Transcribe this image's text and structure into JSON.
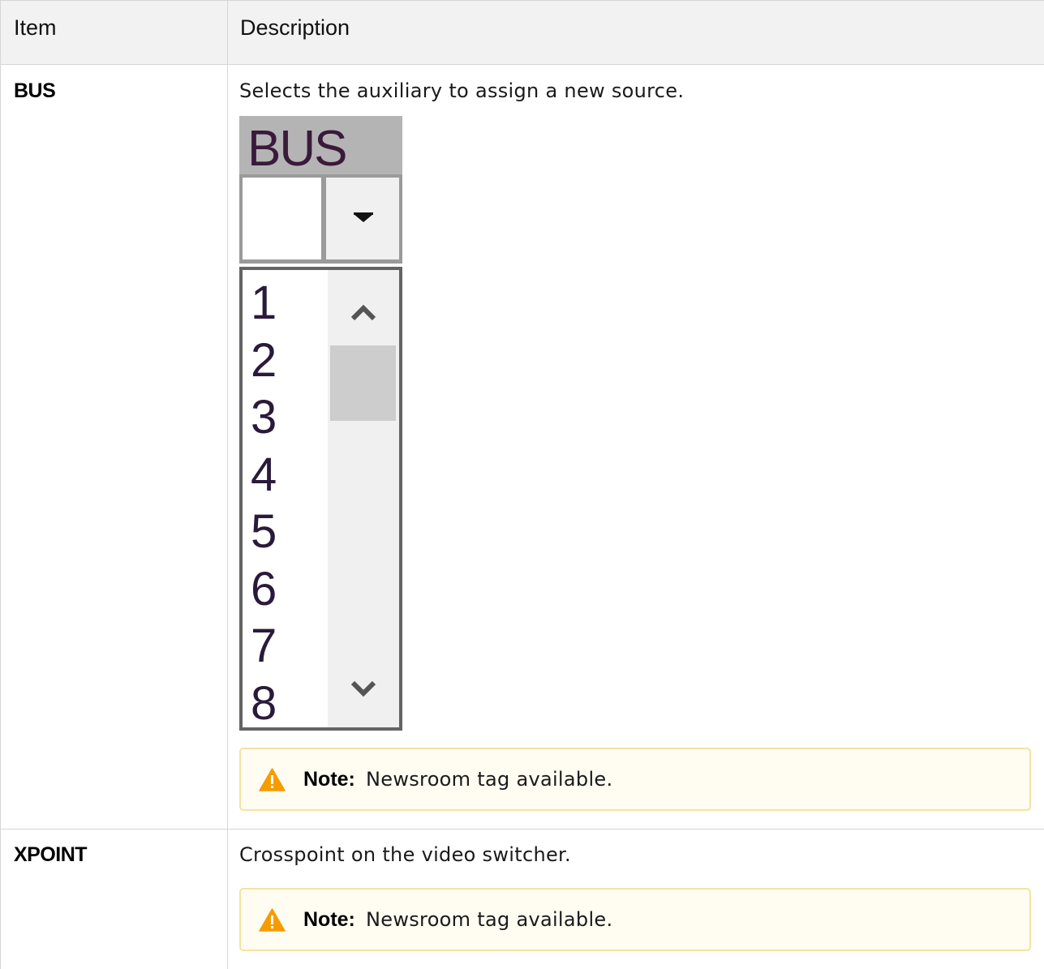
{
  "table": {
    "headers": {
      "item": "Item",
      "description": "Description"
    },
    "rows": [
      {
        "item": "BUS",
        "description": "Selects the auxiliary to assign a new source.",
        "widget": {
          "title": "BUS",
          "list_items": [
            "1",
            "2",
            "3",
            "4",
            "5",
            "6",
            "7",
            "8"
          ]
        },
        "note": {
          "label": "Note:",
          "text": "Newsroom tag available."
        }
      },
      {
        "item": "XPOINT",
        "description": "Crosspoint on the video switcher.",
        "note": {
          "label": "Note:",
          "text": "Newsroom tag available."
        }
      }
    ]
  },
  "colors": {
    "header_bg": "#f2f2f2",
    "note_bg": "#fffcf2",
    "note_border": "#f5e2a3",
    "warning_icon": "#f59c00"
  }
}
